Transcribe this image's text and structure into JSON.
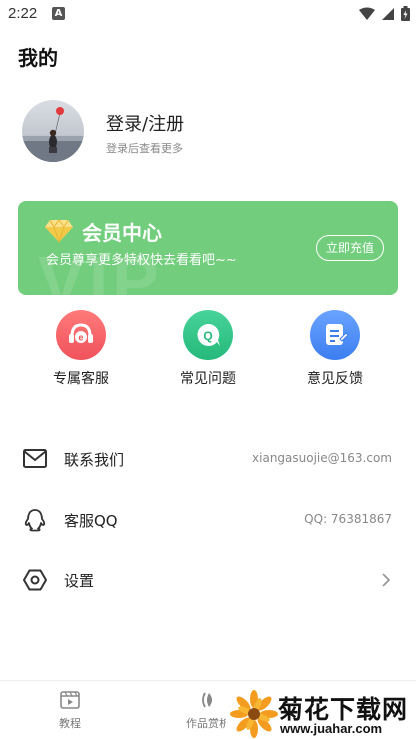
{
  "status_bar": {
    "time": "2:22",
    "notif_badge": "A"
  },
  "page": {
    "title": "我的"
  },
  "profile": {
    "title": "登录/注册",
    "subtitle": "登录后查看更多"
  },
  "vip": {
    "title": "会员中心",
    "description": "会员尊享更多特权快去看看吧~~",
    "button": "立即充值",
    "watermark": "VIP",
    "color": "#72cd7d"
  },
  "quick_actions": [
    {
      "label": "专属客服",
      "icon": "headset-icon",
      "color": "#f0525b"
    },
    {
      "label": "常见问题",
      "icon": "question-chat-icon",
      "color": "#25b97b"
    },
    {
      "label": "意见反馈",
      "icon": "feedback-icon",
      "color": "#3c7ef0"
    }
  ],
  "menu": {
    "contact": {
      "label": "联系我们",
      "value": "xiangasuojie@163.com",
      "icon": "mail-icon"
    },
    "qq": {
      "label": "客服QQ",
      "value": "QQ: 76381867",
      "icon": "qq-icon"
    },
    "settings": {
      "label": "设置",
      "icon": "settings-icon"
    }
  },
  "bottom_nav": [
    {
      "label": "教程",
      "icon": "video-icon"
    },
    {
      "label": "作品赏析",
      "icon": "works-icon"
    }
  ],
  "watermark": {
    "title": "菊花下载网",
    "url": "www.juahar.com"
  }
}
